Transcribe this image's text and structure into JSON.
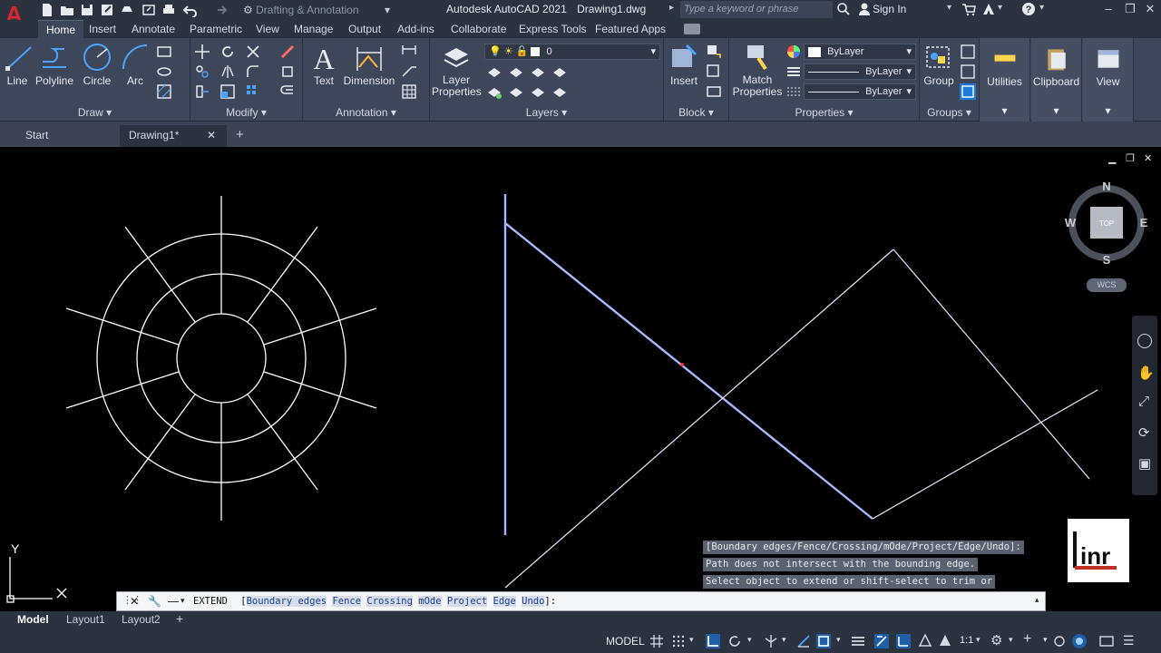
{
  "titlebar": {
    "app_title": "Autodesk AutoCAD 2021",
    "file_name": "Drawing1.dwg",
    "workspace": "Drafting & Annotation",
    "search_placeholder": "Type a keyword or phrase",
    "sign_in": "Sign In"
  },
  "ribbon_tabs": [
    "Home",
    "Insert",
    "Annotate",
    "Parametric",
    "View",
    "Manage",
    "Output",
    "Add-ins",
    "Collaborate",
    "Express Tools",
    "Featured Apps"
  ],
  "draw_panel": {
    "title": "Draw",
    "tools": [
      "Line",
      "Polyline",
      "Circle",
      "Arc"
    ]
  },
  "modify_panel": {
    "title": "Modify"
  },
  "annotation_panel": {
    "title": "Annotation",
    "tools": [
      "Text",
      "Dimension"
    ]
  },
  "layers_panel": {
    "title": "Layers",
    "layer_properties_l1": "Layer",
    "layer_properties_l2": "Properties",
    "current_layer": "0"
  },
  "block_panel": {
    "title": "Block",
    "insert": "Insert"
  },
  "properties_panel": {
    "title": "Properties",
    "match_l1": "Match",
    "match_l2": "Properties",
    "color": "ByLayer",
    "linetype": "ByLayer",
    "lineweight": "ByLayer"
  },
  "groups_panel": {
    "title": "Groups",
    "group": "Group"
  },
  "utilities": "Utilities",
  "clipboard": "Clipboard",
  "view": "View",
  "file_tabs": [
    "Start",
    "Drawing1*"
  ],
  "viewcube": {
    "north": "N",
    "south": "S",
    "east": "E",
    "west": "W",
    "top": "TOP",
    "wcs": "WCS"
  },
  "ucs": {
    "x": "X",
    "y": "Y"
  },
  "history": [
    "[Boundary edges/Fence/Crossing/mOde/Project/Edge/Undo]:",
    "Path does not intersect with the bounding edge.",
    "Select object to extend or shift-select to trim or"
  ],
  "command_line": {
    "command": "EXTEND",
    "open_bracket": "[",
    "options": [
      "Boundary edges",
      "Fence",
      "Crossing",
      "mOde",
      "Project",
      "Edge",
      "Undo"
    ],
    "close": "]:"
  },
  "layout_tabs": [
    "Model",
    "Layout1",
    "Layout2"
  ],
  "status": {
    "model": "MODEL",
    "scale": "1:1"
  },
  "watermark": "inr",
  "colors": {
    "canvas": "#000000",
    "ribbon": "#3e4759",
    "titlebar": "#2b3341",
    "highlight_line": "#a9b8ff",
    "brand_red": "#d9262c"
  }
}
